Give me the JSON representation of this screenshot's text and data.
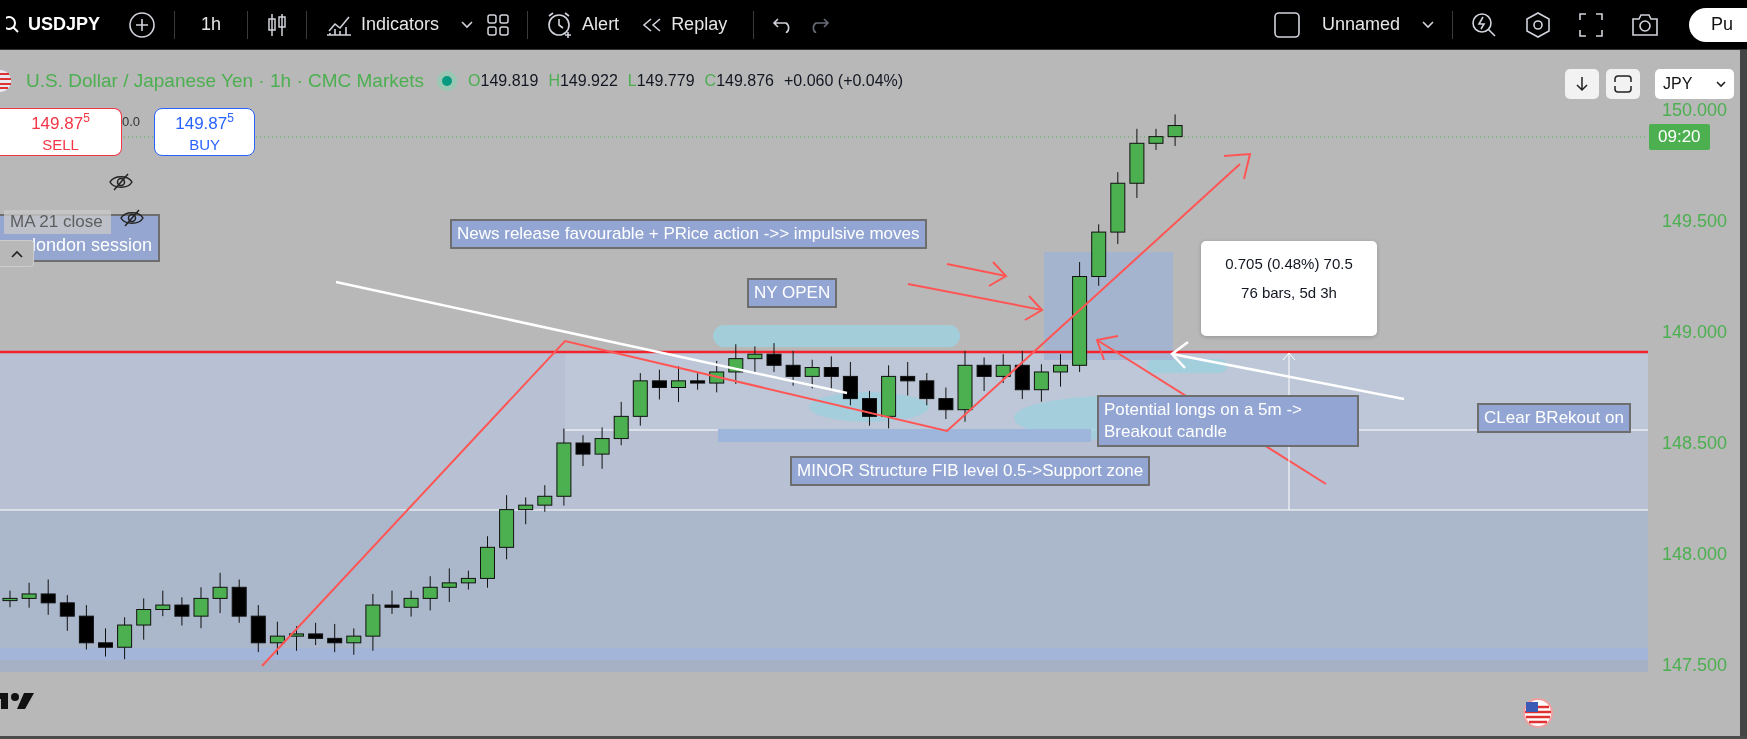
{
  "toolbar": {
    "symbol": "USDJPY",
    "interval": "1h",
    "indicators": "Indicators",
    "alert": "Alert",
    "replay": "Replay",
    "layout_name": "Unnamed",
    "publish": "Pu"
  },
  "legend": {
    "title": "U.S. Dollar / Japanese Yen · 1h · CMC Markets",
    "ohlc": [
      {
        "label": "O",
        "value": "149.819"
      },
      {
        "label": "H",
        "value": "149.922"
      },
      {
        "label": "L",
        "value": "149.779"
      },
      {
        "label": "C",
        "value": "149.876"
      }
    ],
    "change": "+0.060 (+0.04%)"
  },
  "currency": "JPY",
  "trade": {
    "sell_price": "149.87$^{5}$",
    "sell_label": "SELL",
    "spread": "0.0",
    "buy_price": "149.87$^{5}$",
    "buy_label": "BUY"
  },
  "indicator_label": "MA 21 close",
  "side_note": "london session",
  "annotations": [
    {
      "text": "News release favourable + PRice action ->> impulsive moves"
    },
    {
      "text": "NY OPEN"
    },
    {
      "text": "MINOR Structure FIB level 0.5->Support zone"
    },
    {
      "text": "Potential longs on a 5m -> Breakout candle"
    },
    {
      "text": "CLear BRekout on"
    }
  ],
  "measure": {
    "line_1": "0.705 (0.48%) 70.5",
    "line_2": "76 bars, 5d 3h"
  },
  "price_axis": [
    "150.000",
    "149.500",
    "149.000",
    "148.500",
    "148.000",
    "147.500"
  ],
  "countdown": "09:20"
}
